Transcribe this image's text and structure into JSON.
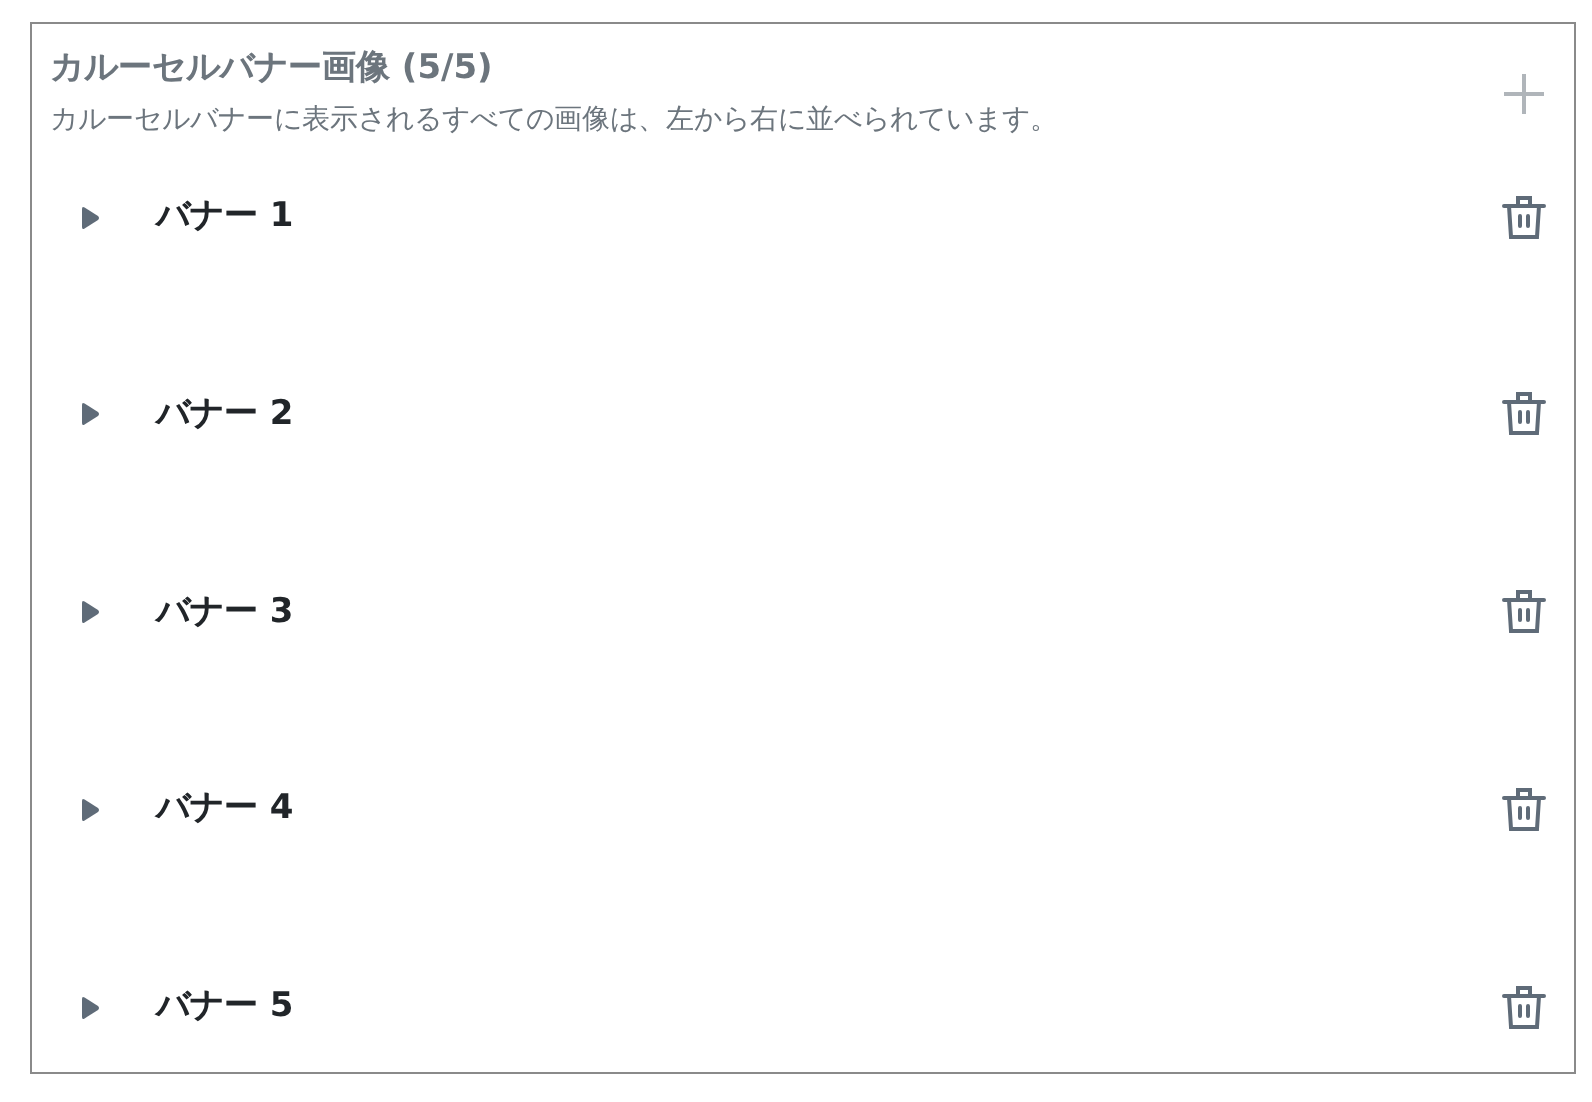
{
  "panel": {
    "title": "カルーセルバナー画像 (5/5)",
    "description": "カルーセルバナーに表示されるすべての画像は、左から右に並べられています。"
  },
  "banners": [
    {
      "label": "バナー 1",
      "expanded": false
    },
    {
      "label": "バナー 2",
      "expanded": false
    },
    {
      "label": "バナー 3",
      "expanded": false
    },
    {
      "label": "バナー 4",
      "expanded": false
    },
    {
      "label": "バナー 5",
      "expanded": false
    }
  ]
}
